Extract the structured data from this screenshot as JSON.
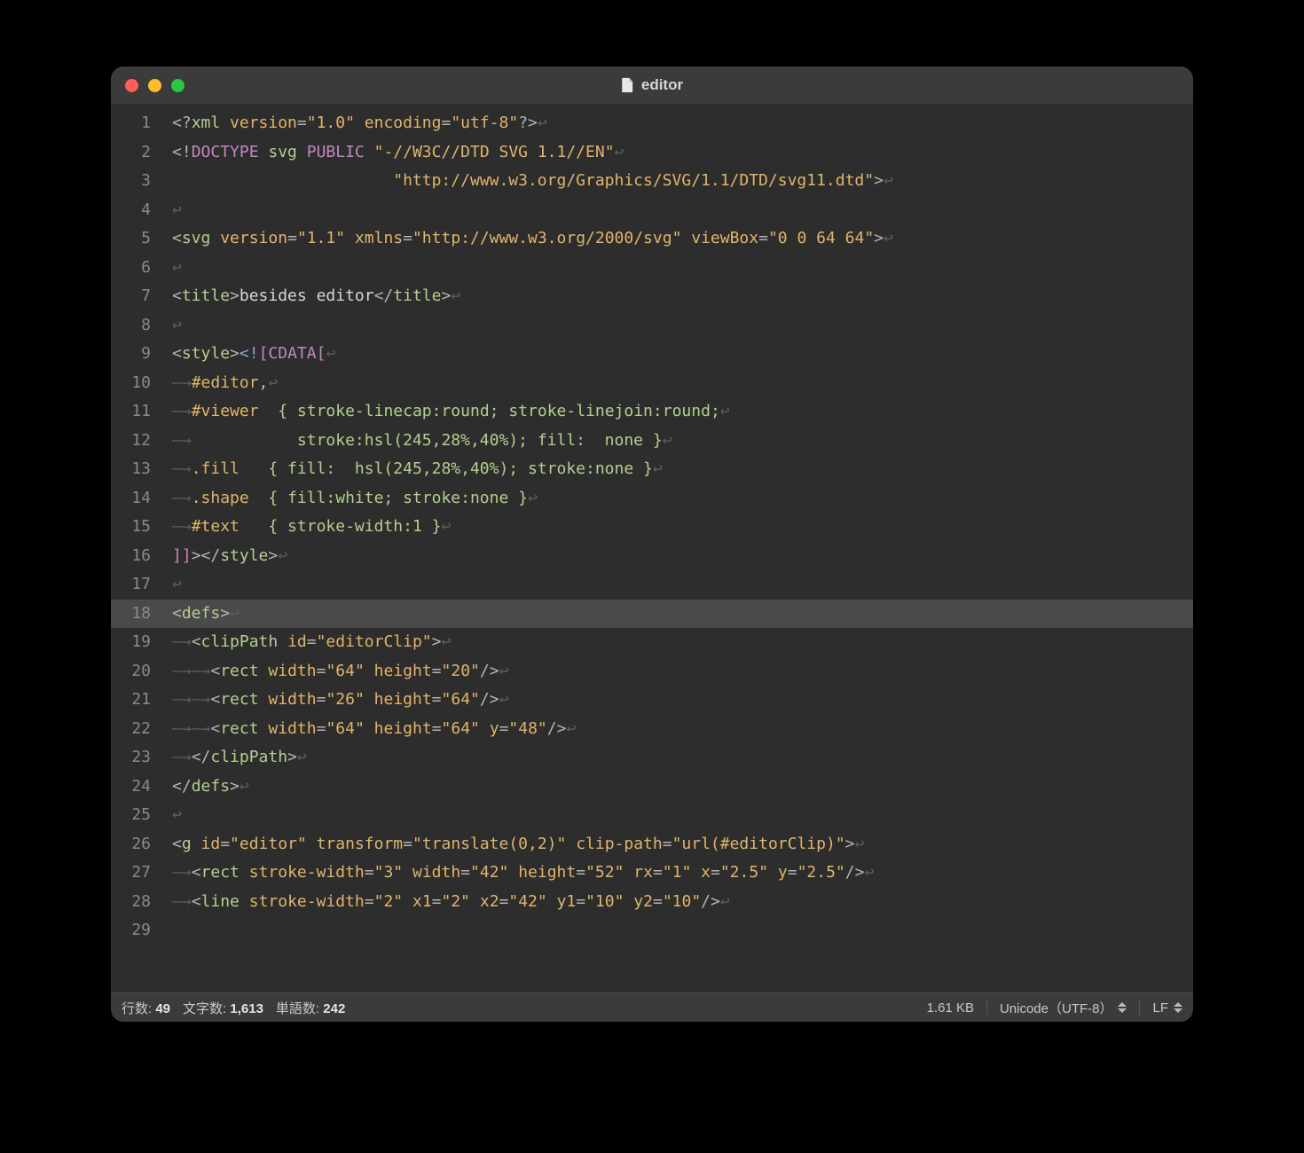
{
  "title": "editor",
  "gutter_start": 1,
  "line_count": 29,
  "highlighted_line": 18,
  "status": {
    "lines_label": "行数:",
    "lines_value": "49",
    "chars_label": "文字数:",
    "chars_value": "1,613",
    "words_label": "単語数:",
    "words_value": "242",
    "filesize": "1.61 KB",
    "encoding": "Unicode（UTF-8）",
    "line_ending": "LF"
  },
  "code": [
    [
      [
        "t-punc",
        "<?"
      ],
      [
        "t-tag",
        "xml"
      ],
      [
        "",
        ""
      ],
      [
        "t-attr",
        " version"
      ],
      [
        "t-punc",
        "="
      ],
      [
        "t-str",
        "\"1.0\""
      ],
      [
        "t-attr",
        " encoding"
      ],
      [
        "t-punc",
        "="
      ],
      [
        "t-str",
        "\"utf-8\""
      ],
      [
        "t-punc",
        "?>"
      ],
      [
        "nl",
        ""
      ]
    ],
    [
      [
        "t-punc",
        "<!"
      ],
      [
        "t-doctype",
        "DOCTYPE"
      ],
      [
        "",
        ""
      ],
      [
        "t-dtname",
        " svg"
      ],
      [
        "t-dtkw",
        " PUBLIC "
      ],
      [
        "t-str",
        "\"-//W3C//DTD SVG 1.1//EN\""
      ],
      [
        "nl",
        ""
      ]
    ],
    [
      [
        "",
        "                       "
      ],
      [
        "t-str",
        "\"http://www.w3.org/Graphics/SVG/1.1/DTD/svg11.dtd\""
      ],
      [
        "t-punc",
        ">"
      ],
      [
        "nl",
        ""
      ]
    ],
    [
      [
        "nl",
        ""
      ]
    ],
    [
      [
        "t-punc",
        "<"
      ],
      [
        "t-tag",
        "svg"
      ],
      [
        "t-attr",
        " version"
      ],
      [
        "t-punc",
        "="
      ],
      [
        "t-str",
        "\"1.1\""
      ],
      [
        "t-attr",
        " xmlns"
      ],
      [
        "t-punc",
        "="
      ],
      [
        "t-str",
        "\"http://www.w3.org/2000/svg\""
      ],
      [
        "t-attr",
        " viewBox"
      ],
      [
        "t-punc",
        "="
      ],
      [
        "t-str",
        "\"0 0 64 64\""
      ],
      [
        "t-punc",
        ">"
      ],
      [
        "nl",
        ""
      ]
    ],
    [
      [
        "nl",
        ""
      ]
    ],
    [
      [
        "t-punc",
        "<"
      ],
      [
        "t-tag",
        "title"
      ],
      [
        "t-punc",
        ">"
      ],
      [
        "",
        "besides editor"
      ],
      [
        "t-punc",
        "</"
      ],
      [
        "t-tag",
        "title"
      ],
      [
        "t-punc",
        ">"
      ],
      [
        "nl",
        ""
      ]
    ],
    [
      [
        "nl",
        ""
      ]
    ],
    [
      [
        "t-punc",
        "<"
      ],
      [
        "t-tag",
        "style"
      ],
      [
        "t-punc",
        ">"
      ],
      [
        "t-cdata",
        "<!"
      ],
      [
        "t-doctype",
        "["
      ],
      [
        "t-doctype",
        "CDATA"
      ],
      [
        "t-doctype",
        "["
      ],
      [
        "nl",
        ""
      ]
    ],
    [
      [
        "tab",
        ""
      ],
      [
        "t-sel",
        "#editor"
      ],
      [
        "t-css",
        ","
      ],
      [
        "nl",
        ""
      ]
    ],
    [
      [
        "tab",
        ""
      ],
      [
        "t-sel",
        "#viewer"
      ],
      [
        "t-css",
        "  { "
      ],
      [
        "t-css",
        "stroke-linecap"
      ],
      [
        "t-css",
        ":"
      ],
      [
        "t-css",
        "round"
      ],
      [
        "t-css",
        "; "
      ],
      [
        "t-css",
        "stroke-linejoin"
      ],
      [
        "t-css",
        ":"
      ],
      [
        "t-css",
        "round"
      ],
      [
        "t-css",
        ";"
      ],
      [
        "nl",
        ""
      ]
    ],
    [
      [
        "tab",
        ""
      ],
      [
        "t-css",
        "           stroke:hsl(245,28%,40%); fill:  none }"
      ],
      [
        "nl",
        ""
      ]
    ],
    [
      [
        "tab",
        ""
      ],
      [
        "t-sel",
        ".fill"
      ],
      [
        "t-css",
        "   { fill:  hsl(245,28%,40%); stroke:none }"
      ],
      [
        "nl",
        ""
      ]
    ],
    [
      [
        "tab",
        ""
      ],
      [
        "t-sel",
        ".shape"
      ],
      [
        "t-css",
        "  { fill:white; stroke:none }"
      ],
      [
        "nl",
        ""
      ]
    ],
    [
      [
        "tab",
        ""
      ],
      [
        "t-sel",
        "#text"
      ],
      [
        "t-css",
        "   { stroke-width:1 }"
      ],
      [
        "nl",
        ""
      ]
    ],
    [
      [
        "t-doctype",
        "]]"
      ],
      [
        "t-punc",
        "></"
      ],
      [
        "t-tag",
        "style"
      ],
      [
        "t-punc",
        ">"
      ],
      [
        "nl",
        ""
      ]
    ],
    [
      [
        "nl",
        ""
      ]
    ],
    [
      [
        "t-punc",
        "<"
      ],
      [
        "t-tag",
        "defs"
      ],
      [
        "t-punc",
        ">"
      ],
      [
        "nl",
        ""
      ]
    ],
    [
      [
        "tab",
        ""
      ],
      [
        "t-punc",
        "<"
      ],
      [
        "t-tag",
        "clipPath"
      ],
      [
        "t-attr",
        " id"
      ],
      [
        "t-punc",
        "="
      ],
      [
        "t-str",
        "\"editorClip\""
      ],
      [
        "t-punc",
        ">"
      ],
      [
        "nl",
        ""
      ]
    ],
    [
      [
        "tab",
        ""
      ],
      [
        "tab",
        ""
      ],
      [
        "t-punc",
        "<"
      ],
      [
        "t-tag",
        "rect"
      ],
      [
        "t-attr",
        " width"
      ],
      [
        "t-punc",
        "="
      ],
      [
        "t-str",
        "\"64\""
      ],
      [
        "t-attr",
        " height"
      ],
      [
        "t-punc",
        "="
      ],
      [
        "t-str",
        "\"20\""
      ],
      [
        "t-punc",
        "/>"
      ],
      [
        "nl",
        ""
      ]
    ],
    [
      [
        "tab",
        ""
      ],
      [
        "tab",
        ""
      ],
      [
        "t-punc",
        "<"
      ],
      [
        "t-tag",
        "rect"
      ],
      [
        "t-attr",
        " width"
      ],
      [
        "t-punc",
        "="
      ],
      [
        "t-str",
        "\"26\""
      ],
      [
        "t-attr",
        " height"
      ],
      [
        "t-punc",
        "="
      ],
      [
        "t-str",
        "\"64\""
      ],
      [
        "t-punc",
        "/>"
      ],
      [
        "nl",
        ""
      ]
    ],
    [
      [
        "tab",
        ""
      ],
      [
        "tab",
        ""
      ],
      [
        "t-punc",
        "<"
      ],
      [
        "t-tag",
        "rect"
      ],
      [
        "t-attr",
        " width"
      ],
      [
        "t-punc",
        "="
      ],
      [
        "t-str",
        "\"64\""
      ],
      [
        "t-attr",
        " height"
      ],
      [
        "t-punc",
        "="
      ],
      [
        "t-str",
        "\"64\""
      ],
      [
        "t-attr",
        " y"
      ],
      [
        "t-punc",
        "="
      ],
      [
        "t-str",
        "\"48\""
      ],
      [
        "t-punc",
        "/>"
      ],
      [
        "nl",
        ""
      ]
    ],
    [
      [
        "tab",
        ""
      ],
      [
        "t-punc",
        "</"
      ],
      [
        "t-tag",
        "clipPath"
      ],
      [
        "t-punc",
        ">"
      ],
      [
        "nl",
        ""
      ]
    ],
    [
      [
        "t-punc",
        "</"
      ],
      [
        "t-tag",
        "defs"
      ],
      [
        "t-punc",
        ">"
      ],
      [
        "nl",
        ""
      ]
    ],
    [
      [
        "nl",
        ""
      ]
    ],
    [
      [
        "t-punc",
        "<"
      ],
      [
        "t-tag",
        "g"
      ],
      [
        "t-attr",
        " id"
      ],
      [
        "t-punc",
        "="
      ],
      [
        "t-str",
        "\"editor\""
      ],
      [
        "t-attr",
        " transform"
      ],
      [
        "t-punc",
        "="
      ],
      [
        "t-str",
        "\"translate(0,2)\""
      ],
      [
        "t-attr",
        " clip-path"
      ],
      [
        "t-punc",
        "="
      ],
      [
        "t-str",
        "\"url(#editorClip)\""
      ],
      [
        "t-punc",
        ">"
      ],
      [
        "nl",
        ""
      ]
    ],
    [
      [
        "tab",
        ""
      ],
      [
        "t-punc",
        "<"
      ],
      [
        "t-tag",
        "rect"
      ],
      [
        "t-attr",
        " stroke-width"
      ],
      [
        "t-punc",
        "="
      ],
      [
        "t-str",
        "\"3\""
      ],
      [
        "t-attr",
        " width"
      ],
      [
        "t-punc",
        "="
      ],
      [
        "t-str",
        "\"42\""
      ],
      [
        "t-attr",
        " height"
      ],
      [
        "t-punc",
        "="
      ],
      [
        "t-str",
        "\"52\""
      ],
      [
        "t-attr",
        " rx"
      ],
      [
        "t-punc",
        "="
      ],
      [
        "t-str",
        "\"1\""
      ],
      [
        "t-attr",
        " x"
      ],
      [
        "t-punc",
        "="
      ],
      [
        "t-str",
        "\"2.5\""
      ],
      [
        "t-attr",
        " y"
      ],
      [
        "t-punc",
        "="
      ],
      [
        "t-str",
        "\"2.5\""
      ],
      [
        "t-punc",
        "/>"
      ],
      [
        "nl",
        ""
      ]
    ],
    [
      [
        "tab",
        ""
      ],
      [
        "t-punc",
        "<"
      ],
      [
        "t-tag",
        "line"
      ],
      [
        "t-attr",
        " stroke-width"
      ],
      [
        "t-punc",
        "="
      ],
      [
        "t-str",
        "\"2\""
      ],
      [
        "t-attr",
        " x1"
      ],
      [
        "t-punc",
        "="
      ],
      [
        "t-str",
        "\"2\""
      ],
      [
        "t-attr",
        " x2"
      ],
      [
        "t-punc",
        "="
      ],
      [
        "t-str",
        "\"42\""
      ],
      [
        "t-attr",
        " y1"
      ],
      [
        "t-punc",
        "="
      ],
      [
        "t-str",
        "\"10\""
      ],
      [
        "t-attr",
        " y2"
      ],
      [
        "t-punc",
        "="
      ],
      [
        "t-str",
        "\"10\""
      ],
      [
        "t-punc",
        "/>"
      ],
      [
        "nl",
        ""
      ]
    ],
    [
      [
        "",
        ""
      ]
    ]
  ]
}
